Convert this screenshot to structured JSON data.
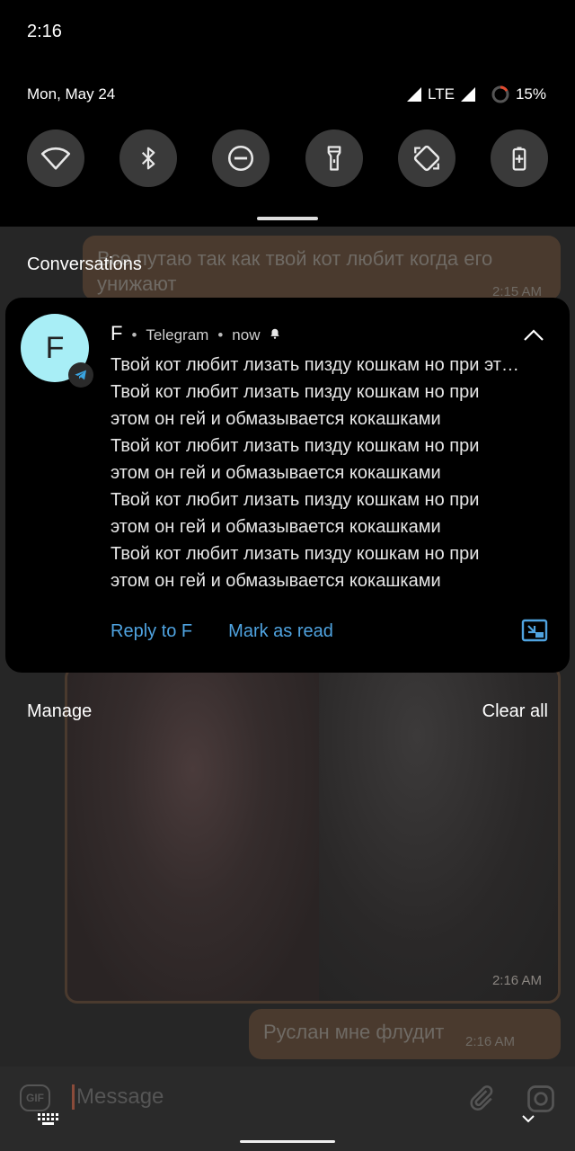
{
  "status_bar": {
    "time": "2:16"
  },
  "quick_settings": {
    "date": "Mon, May 24",
    "network": "LTE",
    "battery": "15%",
    "tiles": [
      {
        "icon": "wifi-icon"
      },
      {
        "icon": "bluetooth-icon"
      },
      {
        "icon": "do-not-disturb-icon"
      },
      {
        "icon": "flashlight-icon"
      },
      {
        "icon": "auto-rotate-icon"
      },
      {
        "icon": "battery-saver-icon"
      }
    ]
  },
  "shade": {
    "section_title": "Conversations"
  },
  "notification": {
    "avatar_letter": "F",
    "sender": "F",
    "app": "Telegram",
    "time": "now",
    "messages": [
      "Твой кот любит лизать пизду кошкам но при эт…",
      "Твой кот любит лизать пизду кошкам но при",
      "этом он гей и обмазывается кокашками",
      "Твой кот любит лизать пизду кошкам но при",
      "этом он гей и обмазывается кокашками",
      "Твой кот любит лизать пизду кошкам но при",
      "этом он гей и обмазывается кокашками",
      "Твой кот любит лизать пизду кошкам но при",
      "этом он гей и обмазывается кокашками"
    ],
    "actions": {
      "reply": "Reply to F",
      "mark_read": "Mark as read"
    },
    "accent_color": "#4fa3e0"
  },
  "shade_footer": {
    "manage": "Manage",
    "clear_all": "Clear all"
  },
  "chat_background": {
    "top_bubble_text": "Все путаю так как твой кот любит когда его унижают",
    "top_bubble_time": "2:15 AM",
    "media_time": "2:16 AM",
    "bottom_bubble_text": "Руслан мне флудит",
    "bottom_bubble_time": "2:16 AM",
    "input_placeholder": "Message",
    "gif_label": "GIF"
  }
}
